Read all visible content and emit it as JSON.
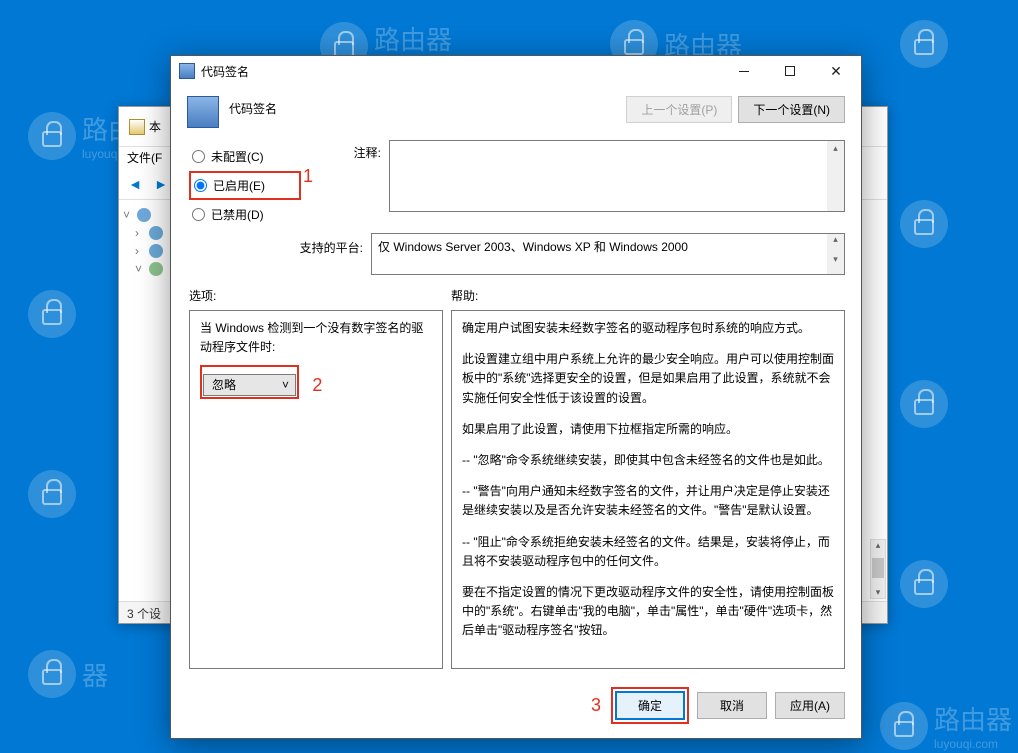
{
  "watermark": {
    "brand": "路由器",
    "url": "luyouqi.com"
  },
  "bgWindow": {
    "titlePrefix": "本",
    "fileMenu": "文件(F",
    "status": "3 个设"
  },
  "dialog": {
    "title": "代码签名",
    "headerTitle": "代码签名",
    "prevBtn": "上一个设置(P)",
    "nextBtn": "下一个设置(N)",
    "radios": {
      "notConfigured": "未配置(C)",
      "enabled": "已启用(E)",
      "disabled": "已禁用(D)"
    },
    "commentLabel": "注释:",
    "platformLabel": "支持的平台:",
    "platformValue": "仅 Windows Server 2003、Windows XP 和 Windows 2000",
    "optionsLabel": "选项:",
    "helpLabel": "帮助:",
    "optionText": "当 Windows 检测到一个没有数字签名的驱动程序文件时:",
    "dropdownValue": "忽略",
    "help": {
      "p1": "确定用户试图安装未经数字签名的驱动程序包时系统的响应方式。",
      "p2": "此设置建立组中用户系统上允许的最少安全响应。用户可以使用控制面板中的\"系统\"选择更安全的设置，但是如果启用了此设置，系统就不会实施任何安全性低于该设置的设置。",
      "p3": "如果启用了此设置，请使用下拉框指定所需的响应。",
      "p4": "-- \"忽略\"命令系统继续安装，即使其中包含未经签名的文件也是如此。",
      "p5": "-- \"警告\"向用户通知未经数字签名的文件，并让用户决定是停止安装还是继续安装以及是否允许安装未经签名的文件。\"警告\"是默认设置。",
      "p6": "-- \"阻止\"命令系统拒绝安装未经签名的文件。结果是，安装将停止，而且将不安装驱动程序包中的任何文件。",
      "p7": "要在不指定设置的情况下更改驱动程序文件的安全性，请使用控制面板中的\"系统\"。右键单击\"我的电脑\"，单击\"属性\"，单击\"硬件\"选项卡，然后单击\"驱动程序签名\"按钮。"
    },
    "buttons": {
      "ok": "确定",
      "cancel": "取消",
      "apply": "应用(A)"
    },
    "annotations": {
      "a1": "1",
      "a2": "2",
      "a3": "3"
    }
  }
}
